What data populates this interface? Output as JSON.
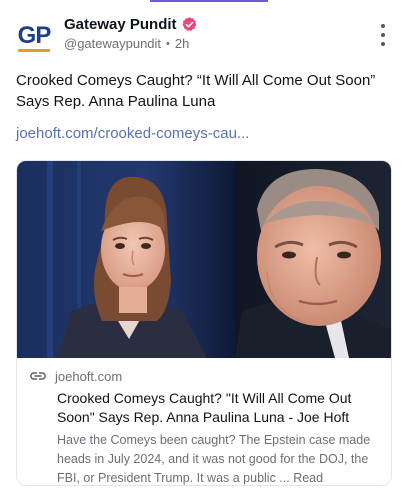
{
  "colors": {
    "accent": "#6e5bd6",
    "verified_badge": "#e8467c",
    "link": "#5b6fb3",
    "logo_blue": "#1e3f8a",
    "logo_gold": "#d7a123"
  },
  "post": {
    "avatar_logo_text": "GP",
    "author_name": "Gateway Pundit",
    "verified_icon": "verified-badge-icon",
    "handle": "@gatewaypundit",
    "separator": "•",
    "time_ago": "2h",
    "more_icon": "more-vertical-icon",
    "text": "Crooked Comeys Caught? “It Will All Come Out Soon” Says Rep. Anna Paulina Luna",
    "link_text": "joehoft.com/crooked-comeys-cau..."
  },
  "link_card": {
    "image_description_icon": "photo-thumbnail",
    "link_icon": "link-icon",
    "domain": "joehoft.com",
    "title": "Crooked Comeys Caught? \"It Will All Come Out Soon\" Says Rep. Anna Paulina Luna - Joe Hoft",
    "description": "Have the Comeys been caught? The Epstein case made heads in July 2024, and it was not good for the DOJ, the FBI, or President Trump. It was a public ... Read"
  }
}
